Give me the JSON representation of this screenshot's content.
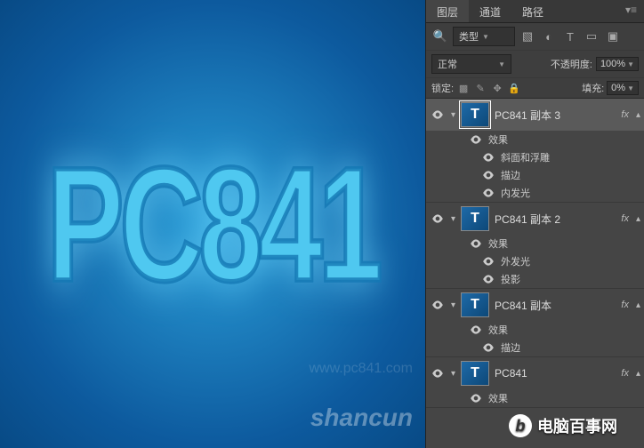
{
  "canvas": {
    "text": "PC841"
  },
  "tabs": {
    "layers": "图层",
    "channels": "通道",
    "paths": "路径"
  },
  "filter": {
    "label": "类型"
  },
  "blend": {
    "mode": "正常",
    "opacity_label": "不透明度:",
    "opacity_value": "100%"
  },
  "lock": {
    "label": "锁定:",
    "fill_label": "填充:",
    "fill_value": "0%"
  },
  "fx": {
    "label": "fx",
    "effects": "效果"
  },
  "layers": [
    {
      "name": "PC841 副本 3",
      "selected": true,
      "effects": [
        "斜面和浮雕",
        "描边",
        "内发光"
      ]
    },
    {
      "name": "PC841 副本 2",
      "selected": false,
      "effects": [
        "外发光",
        "投影"
      ]
    },
    {
      "name": "PC841 副本",
      "selected": false,
      "effects": [
        "描边"
      ]
    },
    {
      "name": "PC841",
      "selected": false,
      "effects_label_only": "效果"
    }
  ],
  "watermarks": {
    "w1": "www.pc841.com",
    "w2": "电脑百事网",
    "w3": "shancun"
  }
}
